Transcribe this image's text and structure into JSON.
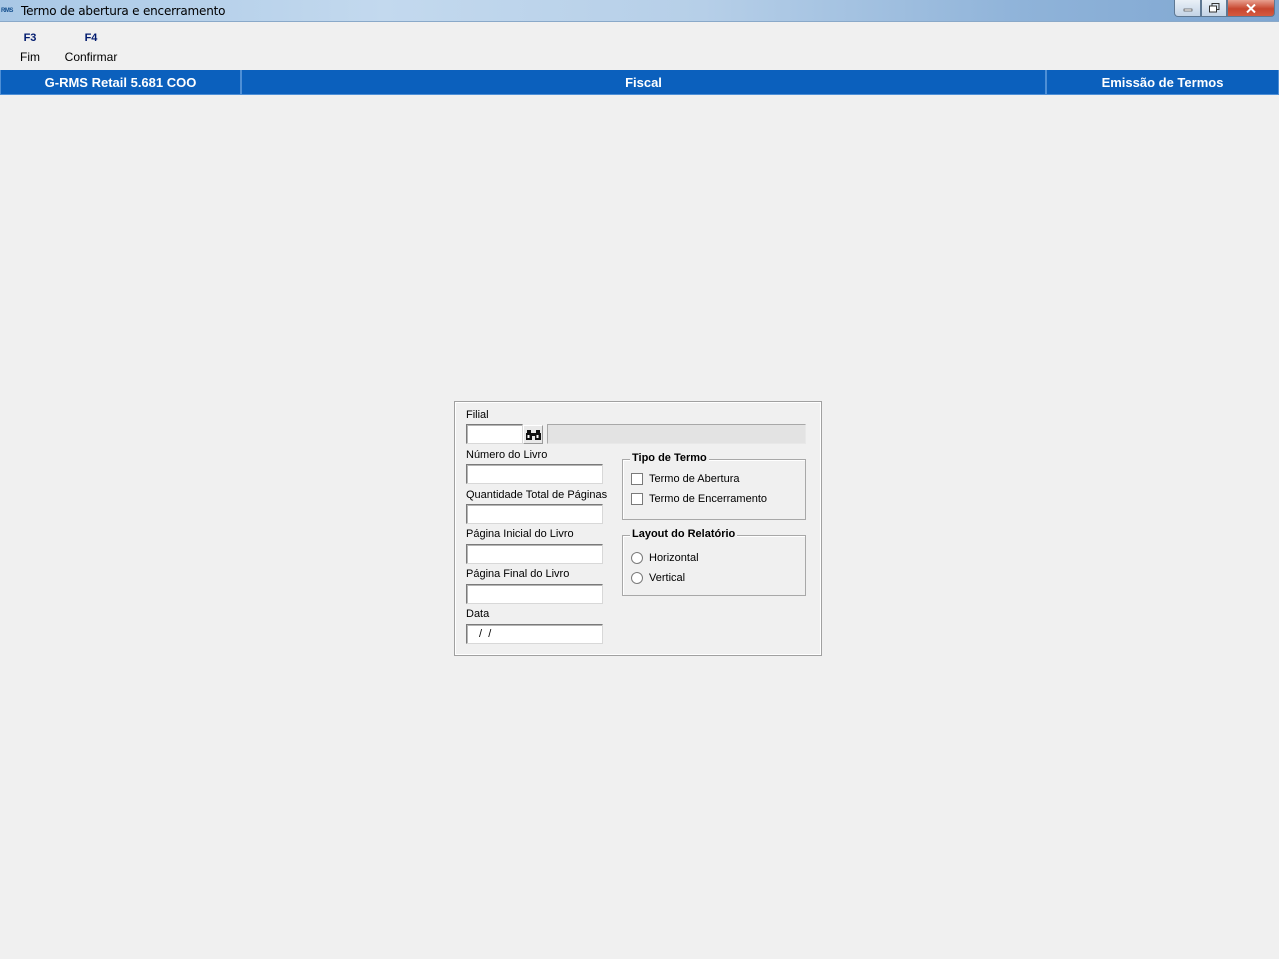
{
  "window": {
    "title": "Termo de abertura e encerramento",
    "app_icon_text": "RMS"
  },
  "toolbar": {
    "items": [
      {
        "key": "F3",
        "label": "Fim"
      },
      {
        "key": "F4",
        "label": "Confirmar"
      }
    ]
  },
  "header_band": {
    "left": "G-RMS Retail 5.681 COO",
    "center": "Fiscal",
    "right": "Emissão de Termos"
  },
  "form": {
    "filial": {
      "label": "Filial",
      "value": "",
      "description": ""
    },
    "numero_livro": {
      "label": "Número do Livro",
      "value": ""
    },
    "qtd_paginas": {
      "label": "Quantidade Total de Páginas",
      "value": ""
    },
    "pagina_inicial": {
      "label": "Página Inicial do Livro",
      "value": ""
    },
    "pagina_final": {
      "label": "Página Final do Livro",
      "value": ""
    },
    "data": {
      "label": "Data",
      "value": " /  /"
    },
    "tipo_termo": {
      "title": "Tipo de Termo",
      "options": [
        {
          "label": "Termo de Abertura",
          "checked": false
        },
        {
          "label": "Termo de Encerramento",
          "checked": false
        }
      ]
    },
    "layout_relatorio": {
      "title": "Layout do Relatório",
      "options": [
        {
          "label": "Horizontal",
          "selected": false
        },
        {
          "label": "Vertical",
          "selected": false
        }
      ]
    }
  },
  "icons": {
    "search": "binoculars-icon",
    "minimize": "minimize-icon",
    "maximize": "restore-icon",
    "close": "close-icon"
  },
  "colors": {
    "header_band": "#0b60bd",
    "toolbar_key": "#001a6e",
    "background": "#f0f0f0"
  }
}
